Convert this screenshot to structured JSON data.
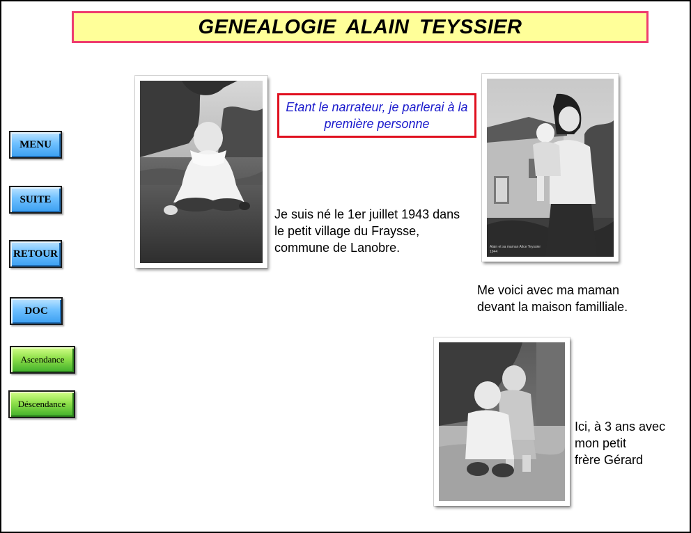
{
  "header": {
    "title": "GENEALOGIE  ALAIN  TEYSSIER"
  },
  "nav": {
    "menu": "MENU",
    "suite": "SUITE",
    "retour": "RETOUR",
    "doc": "DOC",
    "ascendance": "Ascendance",
    "descendance": "Déscendance"
  },
  "narrator_note": "Etant le narrateur, je parlerai à la première personne",
  "captions": {
    "birth": [
      "Je suis né le 1er juillet 1943 dans",
      "le petit village du Fraysse,",
      "commune de Lanobre."
    ],
    "mother": [
      "Me voici avec ma maman",
      "devant la maison familliale."
    ],
    "brother": [
      "Ici, à 3 ans avec",
      "mon petit",
      "frère Gérard"
    ]
  },
  "colors": {
    "title_bg": "#ffff99",
    "title_border": "#ee3c6e",
    "note_border": "#e0101f",
    "note_text": "#1a1acc",
    "nav_blue": "#6ec0ff",
    "nav_green": "#8fe04a"
  }
}
